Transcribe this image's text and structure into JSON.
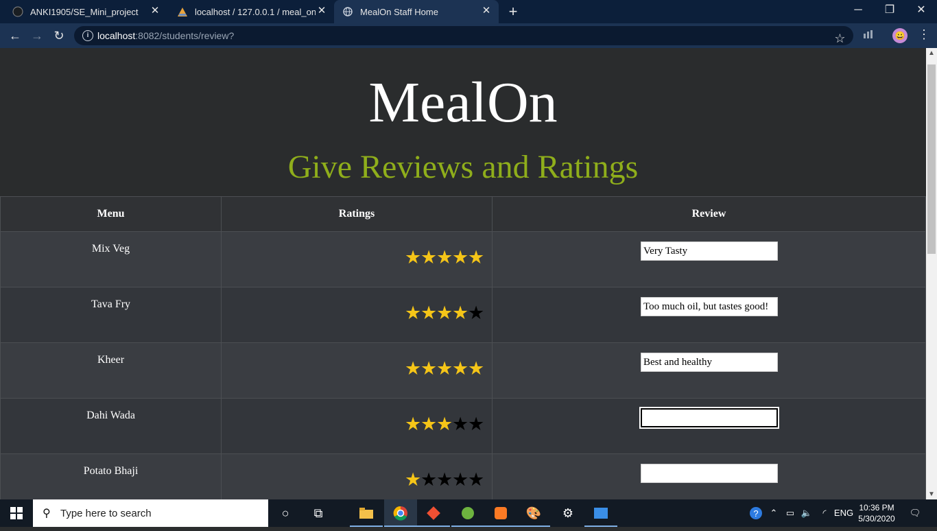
{
  "browser": {
    "tabs": [
      {
        "title": "ANKI1905/SE_Mini_project",
        "icon": "github-icon",
        "active": false
      },
      {
        "title": "localhost / 127.0.0.1 / meal_on /",
        "icon": "phpmyadmin-icon",
        "active": false
      },
      {
        "title": "MealOn Staff Home",
        "icon": "globe-icon",
        "active": true
      }
    ],
    "url_host": "localhost",
    "url_rest": ":8082/students/review?"
  },
  "page": {
    "brand": "MealOn",
    "subtitle": "Give Reviews and Ratings",
    "colors": {
      "subtitle": "#8fae1b",
      "star_on": "#f5c518",
      "star_off": "#000000"
    },
    "table": {
      "headers": {
        "menu": "Menu",
        "ratings": "Ratings",
        "review": "Review"
      },
      "rows": [
        {
          "dish": "Mix Veg",
          "rating": 5,
          "review": "Very Tasty"
        },
        {
          "dish": "Tava Fry",
          "rating": 4,
          "review": "Too much oil, but tastes good!"
        },
        {
          "dish": "Kheer",
          "rating": 5,
          "review": "Best and healthy"
        },
        {
          "dish": "Dahi Wada",
          "rating": 3,
          "review": ""
        },
        {
          "dish": "Potato Bhaji",
          "rating": 1,
          "review": ""
        }
      ]
    }
  },
  "taskbar": {
    "search_placeholder": "Type here to search",
    "language": "ENG",
    "time": "10:36 PM",
    "date": "5/30/2020"
  }
}
